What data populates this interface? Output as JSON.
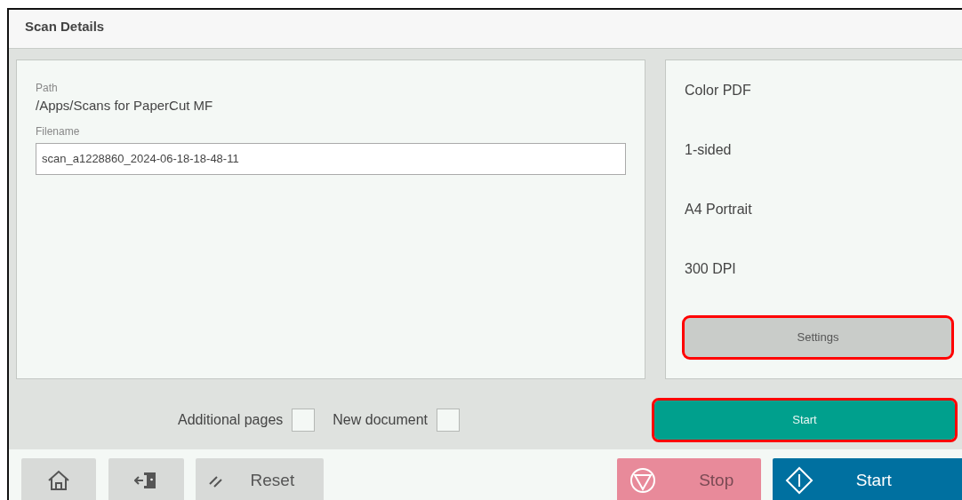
{
  "header": {
    "title": "Scan Details"
  },
  "destination": {
    "path_label": "Path",
    "path": "/Apps/Scans for PaperCut MF",
    "filename_label": "Filename",
    "filename": "scan_a1228860_2024-06-18-18-48-11"
  },
  "settings_summary": [
    "Color PDF",
    "1-sided",
    "A4 Portrait",
    "300 DPI"
  ],
  "settings_button": {
    "label": "Settings",
    "highlighted": true
  },
  "options": [
    {
      "label": "Additional pages",
      "checked": false
    },
    {
      "label": "New document",
      "checked": false
    }
  ],
  "start_button": {
    "label": "Start",
    "highlighted": true
  },
  "bottom_bar": [
    {
      "kind": "home"
    },
    {
      "kind": "logout"
    },
    {
      "kind": "reset",
      "label": "Reset"
    },
    {
      "kind": "stop",
      "label": "Stop"
    },
    {
      "kind": "start",
      "label": "Start"
    }
  ]
}
